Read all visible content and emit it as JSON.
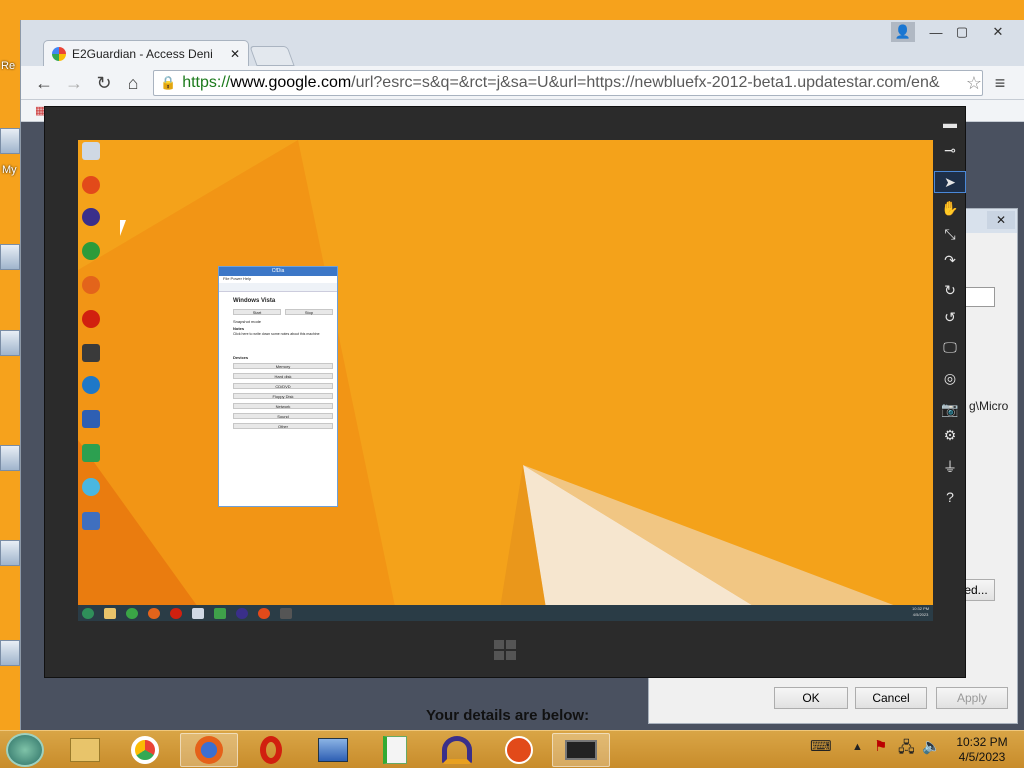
{
  "browser": {
    "tab_title": "E2Guardian - Access Deni",
    "url_https": "https://",
    "url_host": "www.google.com",
    "url_rest": "/url?esrc=s&q=&rct=j&sa=U&url=https://newbluefx-2012-beta1.updatestar.com/en&"
  },
  "dialog": {
    "text_fragment": "g\\Micro",
    "advanced_label": "ed...",
    "ok_label": "OK",
    "cancel_label": "Cancel",
    "apply_label": "Apply"
  },
  "page": {
    "details_text": "Your details are below:"
  },
  "desktop_left": {
    "re": "Re",
    "my": "My"
  },
  "vm": {
    "config_title": "CfDia",
    "menu": "File   Power   Help",
    "os_name": "Windows Vista",
    "start_label": "Start",
    "stop_label": "Stop",
    "snapshot": "Snapshot mode",
    "notes_label": "Notes",
    "notes_hint": "Click here to write down some notes about this machine",
    "devices_label": "Devices",
    "devices": [
      "Memory",
      "Hard disk",
      "CD/DVD",
      "Floppy Disk",
      "Network",
      "Sound",
      "Other"
    ],
    "tray_time": "10:32 PM",
    "tray_date": "4/5/2023"
  },
  "taskbar": {
    "time": "10:32 PM",
    "date": "4/5/2023"
  },
  "colors": {
    "desktop": "#f6a21c",
    "vm_frame": "#2b2b2b",
    "taskbar": "#d9a546"
  }
}
